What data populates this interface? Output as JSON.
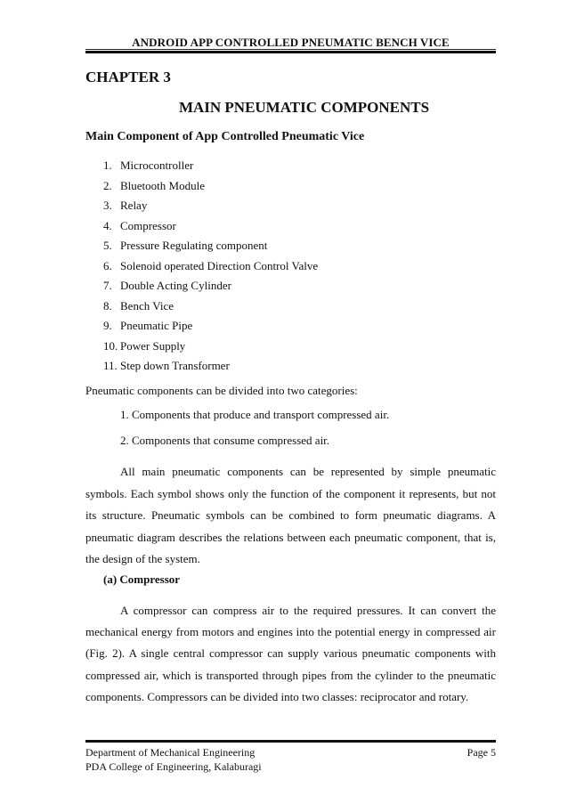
{
  "header": {
    "running_title": "ANDROID APP CONTROLLED PNEUMATIC BENCH VICE"
  },
  "chapter": {
    "label": "CHAPTER 3",
    "title": "MAIN PNEUMATIC COMPONENTS"
  },
  "main_components": {
    "heading": "Main Component of App Controlled Pneumatic Vice",
    "items": [
      {
        "num": "1.",
        "label": "Microcontroller"
      },
      {
        "num": "2.",
        "label": "Bluetooth Module"
      },
      {
        "num": "3.",
        "label": "Relay"
      },
      {
        "num": "4.",
        "label": "Compressor"
      },
      {
        "num": "5.",
        "label": "Pressure Regulating component"
      },
      {
        "num": "6.",
        "label": "Solenoid operated Direction Control Valve"
      },
      {
        "num": "7.",
        "label": "Double Acting Cylinder"
      },
      {
        "num": "8.",
        "label": "Bench Vice"
      },
      {
        "num": "9.",
        "label": "Pneumatic Pipe"
      },
      {
        "num": "10.",
        "label": "Power Supply"
      },
      {
        "num": "11.",
        "label": "Step down Transformer"
      }
    ]
  },
  "categories": {
    "intro": "Pneumatic components can be divided into two categories:",
    "items": [
      "1. Components that produce and transport compressed air.",
      "2. Components that consume compressed air."
    ]
  },
  "symbols_paragraph": "All main pneumatic components can be represented by simple pneumatic symbols. Each symbol shows only the function of the component it represents, but not its structure. Pneumatic symbols can be combined to form pneumatic diagrams. A pneumatic diagram describes the relations between each pneumatic component, that is, the design of the system.",
  "compressor_section": {
    "heading": "(a) Compressor",
    "paragraph": "A compressor can compress air to the required pressures. It can convert the mechanical energy from motors and engines into the potential energy in compressed air (Fig. 2). A single central compressor can supply various pneumatic components with compressed air, which is transported through pipes from the cylinder to the pneumatic components. Compressors can be divided into two classes: reciprocator and rotary."
  },
  "footer": {
    "department": "Department of Mechanical Engineering",
    "college": "PDA College of Engineering, Kalaburagi",
    "page_label": "Page 5"
  }
}
